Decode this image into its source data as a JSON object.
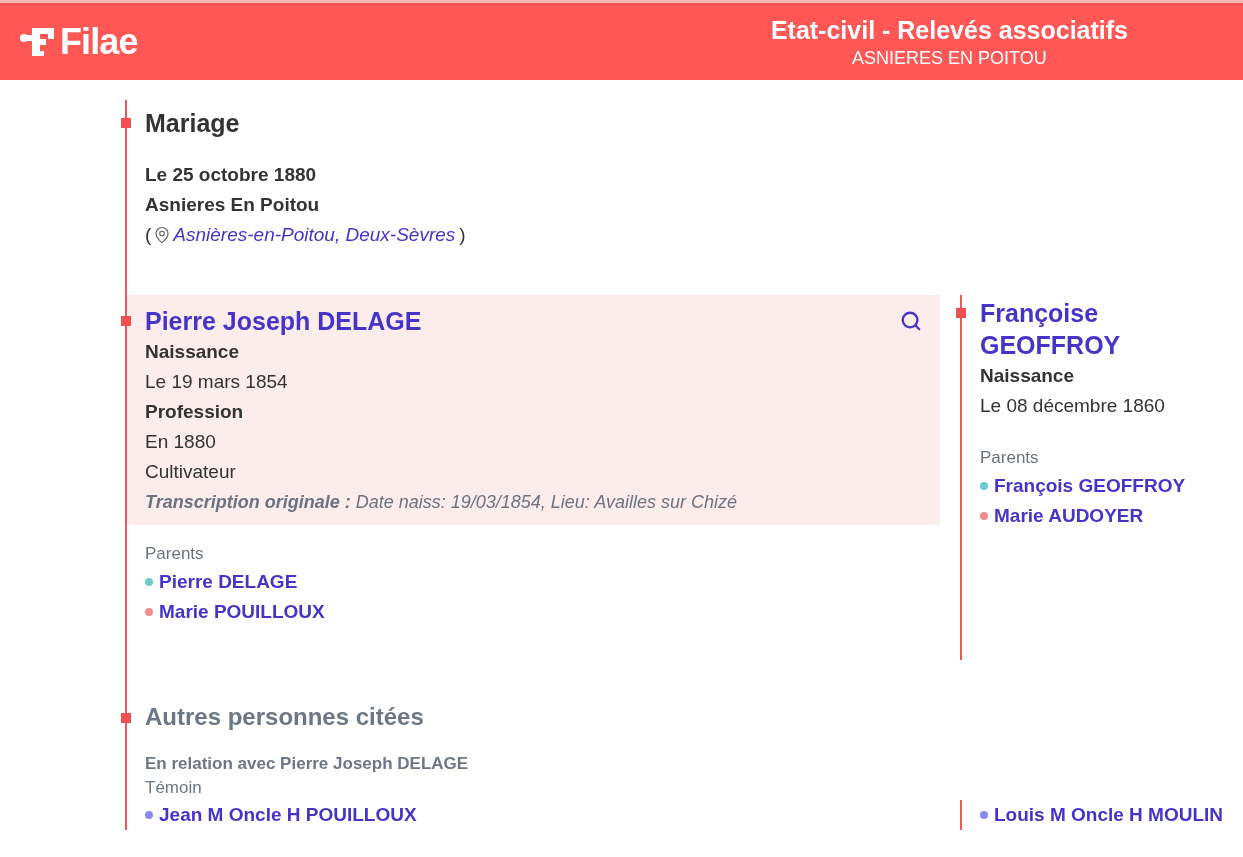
{
  "header": {
    "logo": "Filae",
    "title": "Etat-civil - Relevés associatifs",
    "subtitle": "ASNIERES EN POITOU"
  },
  "event": {
    "title": "Mariage",
    "date": "Le 25 octobre 1880",
    "place": "Asnieres En Poitou",
    "open_paren": "(",
    "location_link": "Asnières-en-Poitou, Deux-Sèvres",
    "close_paren": ")"
  },
  "people": [
    {
      "name": "Pierre Joseph DELAGE",
      "highlighted": true,
      "facts": [
        {
          "kind": "label",
          "text": "Naissance"
        },
        {
          "kind": "value",
          "text": "Le 19 mars 1854"
        },
        {
          "kind": "label",
          "text": "Profession"
        },
        {
          "kind": "value",
          "text": "En 1880"
        },
        {
          "kind": "value",
          "text": "Cultivateur"
        },
        {
          "kind": "note",
          "text": "**Transcription originale :** Date naiss: 19/03/1854, Lieu: Availles sur Chizé"
        }
      ],
      "parents_label": "Parents",
      "parents": [
        {
          "name": "Pierre DELAGE",
          "color": "#6ccccc"
        },
        {
          "name": "Marie POUILLOUX",
          "color": "#f28b8b"
        }
      ]
    },
    {
      "name": "Françoise GEOFFROY",
      "highlighted": false,
      "facts": [
        {
          "kind": "label",
          "text": "Naissance"
        },
        {
          "kind": "value",
          "text": "Le 08 décembre 1860"
        }
      ],
      "parents_label": "Parents",
      "parents": [
        {
          "name": "François GEOFFROY",
          "color": "#6ccccc"
        },
        {
          "name": "Marie AUDOYER",
          "color": "#f28b8b"
        }
      ]
    }
  ],
  "others": {
    "title": "Autres personnes citées",
    "relation": "En relation avec Pierre Joseph DELAGE",
    "role": "Témoin",
    "persons": [
      {
        "name": "Jean M Oncle H POUILLOUX",
        "color": "#8c88f2"
      },
      {
        "name": "Louis M Oncle H MOULIN",
        "color": "#8c88f2"
      }
    ]
  }
}
